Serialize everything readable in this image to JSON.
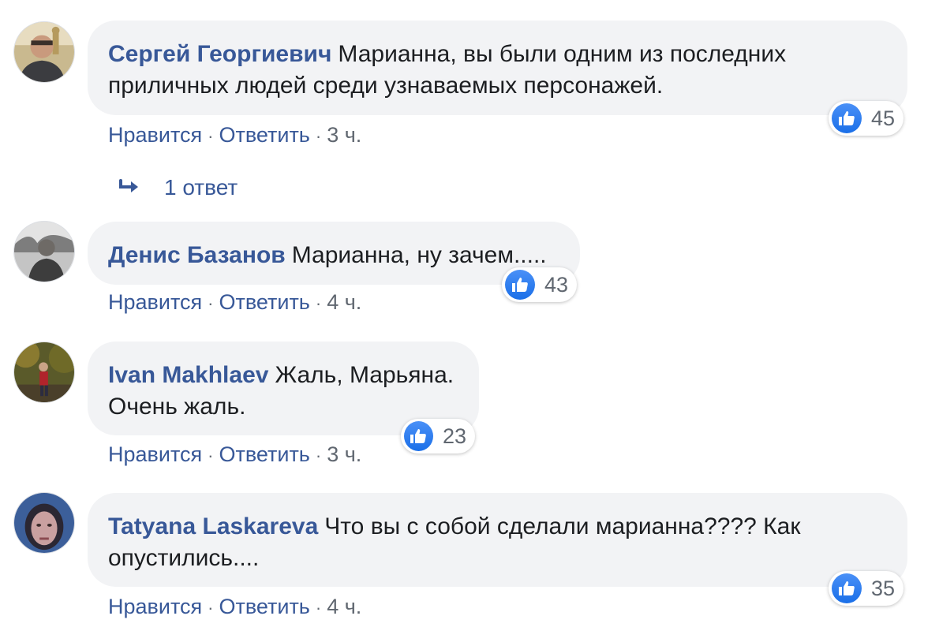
{
  "comments": [
    {
      "author": "Сергей Георгиевич",
      "text_line1": "Марианна, вы были одним из последних",
      "text_line2": "приличных людей среди узнаваемых персонажей.",
      "like_label": "Нравится",
      "reply_label": "Ответить",
      "time": "3 ч.",
      "reactions_count": "45",
      "replies_label": "1 ответ"
    },
    {
      "author": "Денис Базанов",
      "text_line1": "Марианна, ну зачем.....",
      "like_label": "Нравится",
      "reply_label": "Ответить",
      "time": "4 ч.",
      "reactions_count": "43"
    },
    {
      "author": "Ivan Makhlaev",
      "text_line1": "Жаль, Марьяна.",
      "text_line2": "Очень жаль.",
      "like_label": "Нравится",
      "reply_label": "Ответить",
      "time": "3 ч.",
      "reactions_count": "23"
    },
    {
      "author": "Tatyana Laskareva",
      "text_line1": "Что вы с собой сделали марианна???? Как",
      "text_line2": "опустились....",
      "like_label": "Нравится",
      "reply_label": "Ответить",
      "time": "4 ч.",
      "reactions_count": "35"
    }
  ],
  "icons": {
    "like": "thumbs-up-icon",
    "reply_arrow": "reply-arrow-icon"
  },
  "colors": {
    "author": "#385898",
    "bubble_bg": "#f2f3f5",
    "like_icon": "#1a6fe8",
    "meta": "#606770"
  }
}
